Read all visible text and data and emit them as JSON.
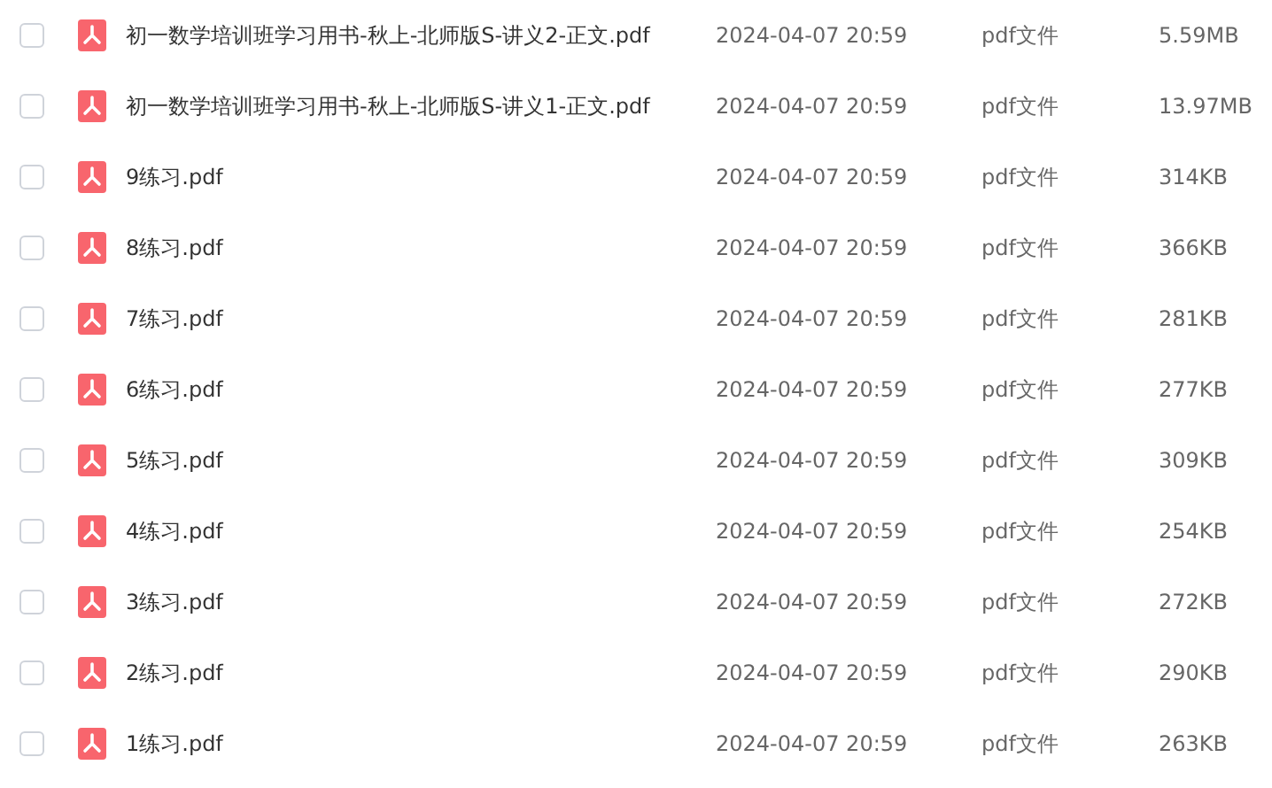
{
  "files": [
    {
      "name": "初一数学培训班学习用书-秋上-北师版S-讲义2-正文.pdf",
      "modified": "2024-04-07 20:59",
      "type": "pdf文件",
      "size": "5.59MB",
      "checked": false
    },
    {
      "name": "初一数学培训班学习用书-秋上-北师版S-讲义1-正文.pdf",
      "modified": "2024-04-07 20:59",
      "type": "pdf文件",
      "size": "13.97MB",
      "checked": false
    },
    {
      "name": "9练习.pdf",
      "modified": "2024-04-07 20:59",
      "type": "pdf文件",
      "size": "314KB",
      "checked": false
    },
    {
      "name": "8练习.pdf",
      "modified": "2024-04-07 20:59",
      "type": "pdf文件",
      "size": "366KB",
      "checked": false
    },
    {
      "name": "7练习.pdf",
      "modified": "2024-04-07 20:59",
      "type": "pdf文件",
      "size": "281KB",
      "checked": false
    },
    {
      "name": "6练习.pdf",
      "modified": "2024-04-07 20:59",
      "type": "pdf文件",
      "size": "277KB",
      "checked": false
    },
    {
      "name": "5练习.pdf",
      "modified": "2024-04-07 20:59",
      "type": "pdf文件",
      "size": "309KB",
      "checked": false
    },
    {
      "name": "4练习.pdf",
      "modified": "2024-04-07 20:59",
      "type": "pdf文件",
      "size": "254KB",
      "checked": false
    },
    {
      "name": "3练习.pdf",
      "modified": "2024-04-07 20:59",
      "type": "pdf文件",
      "size": "272KB",
      "checked": false
    },
    {
      "name": "2练习.pdf",
      "modified": "2024-04-07 20:59",
      "type": "pdf文件",
      "size": "290KB",
      "checked": false
    },
    {
      "name": "1练习.pdf",
      "modified": "2024-04-07 20:59",
      "type": "pdf文件",
      "size": "263KB",
      "checked": false
    }
  ]
}
